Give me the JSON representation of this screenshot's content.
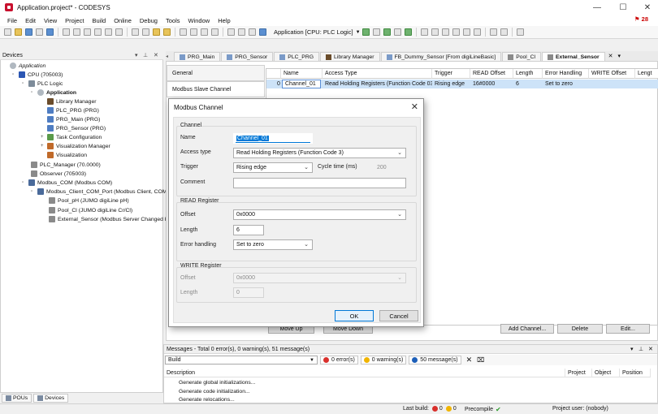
{
  "window": {
    "title": "Application.project* - CODESYS",
    "minimize": "—",
    "maximize": "☐",
    "close": "✕"
  },
  "menu": {
    "items": [
      "File",
      "Edit",
      "View",
      "Project",
      "Build",
      "Online",
      "Debug",
      "Tools",
      "Window",
      "Help"
    ],
    "badge": "28"
  },
  "toolbar": {
    "app_selector": "Application [CPU: PLC Logic]"
  },
  "devices": {
    "header": "Devices",
    "tree": [
      {
        "label": "Application",
        "icon": "app",
        "italic": true
      },
      {
        "label": "CPU (705003)",
        "icon": "cpu"
      },
      {
        "label": "PLC Logic",
        "icon": "plc"
      },
      {
        "label": "Application",
        "icon": "app",
        "bold": true
      },
      {
        "label": "Library Manager",
        "icon": "lib"
      },
      {
        "label": "PLC_PRG (PRG)",
        "icon": "pou"
      },
      {
        "label": "PRG_Main (PRG)",
        "icon": "pou"
      },
      {
        "label": "PRG_Sensor (PRG)",
        "icon": "pou"
      },
      {
        "label": "Task Configuration",
        "icon": "task"
      },
      {
        "label": "Visualization Manager",
        "icon": "vis"
      },
      {
        "label": "Visualization",
        "icon": "vis"
      },
      {
        "label": "PLC_Manager (70.0000)",
        "icon": "dev"
      },
      {
        "label": "Observer (705003)",
        "icon": "dev"
      },
      {
        "label": "Modbus_COM (Modbus COM)",
        "icon": "mod"
      },
      {
        "label": "Modbus_Client_COM_Port (Modbus Client, COM P...",
        "icon": "mod"
      },
      {
        "label": "Pool_pH (JUMO digiLine pH)",
        "icon": "dev"
      },
      {
        "label": "Pool_Cl (JUMO digiLine Cr/Cl)",
        "icon": "dev"
      },
      {
        "label": "External_Sensor (Modbus Server Changed b...",
        "icon": "dev"
      }
    ],
    "bottom_tabs": [
      "POUs",
      "Devices"
    ]
  },
  "editor": {
    "tabs": [
      "PRG_Main",
      "PRG_Sensor",
      "PLC_PRG",
      "Library Manager",
      "FB_Dummy_Sensor [From digiLineBasic]",
      "Pool_Cl",
      "External_Sensor"
    ],
    "side_nav": [
      "General",
      "Modbus Slave Channel"
    ],
    "columns": [
      "",
      "Name",
      "Access Type",
      "Trigger",
      "READ Offset",
      "Length",
      "Error Handling",
      "WRITE Offset",
      "Lengt"
    ],
    "rows": [
      [
        "0",
        "Channel_01",
        "Read Holding Registers (Function Code 03)",
        "Rising edge",
        "16#0000",
        "6",
        "Set to zero",
        "",
        ""
      ]
    ],
    "buttons": {
      "move_up": "Move Up",
      "move_down": "Move Down",
      "add_channel": "Add Channel...",
      "delete": "Delete",
      "edit": "Edit..."
    }
  },
  "dialog": {
    "title": "Modbus Channel",
    "channel_group": "Channel",
    "name_label": "Name",
    "name_value": "Channel_01",
    "access_label": "Access type",
    "access_value": "Read Holding Registers (Function Code 3)",
    "trigger_label": "Trigger",
    "trigger_value": "Rising edge",
    "cycle_label": "Cycle time (ms)",
    "cycle_value": "200",
    "comment_label": "Comment",
    "comment_value": "",
    "read_group": "READ Register",
    "read_offset_label": "Offset",
    "read_offset_value": "0x0000",
    "read_length_label": "Length",
    "read_length_value": "6",
    "error_label": "Error handling",
    "error_value": "Set to zero",
    "write_group": "WRITE Register",
    "write_offset_label": "Offset",
    "write_offset_value": "0x0000",
    "write_length_label": "Length",
    "write_length_value": "0",
    "ok": "OK",
    "cancel": "Cancel"
  },
  "messages": {
    "header": "Messages - Total 0 error(s), 0 warning(s), 51 message(s)",
    "filter": "Build",
    "errors": "0 error(s)",
    "warnings": "0 warning(s)",
    "messages": "50 message(s)",
    "columns": [
      "Description",
      "Project",
      "Object",
      "Position"
    ],
    "rows": [
      "Generate global initializations...",
      "Generate code initialization...",
      "Generate relocations..."
    ]
  },
  "status": {
    "last_build": "Last build:",
    "errors": "0",
    "warnings": "0",
    "precompile": "Precompile",
    "user": "Project user: (nobody)"
  }
}
